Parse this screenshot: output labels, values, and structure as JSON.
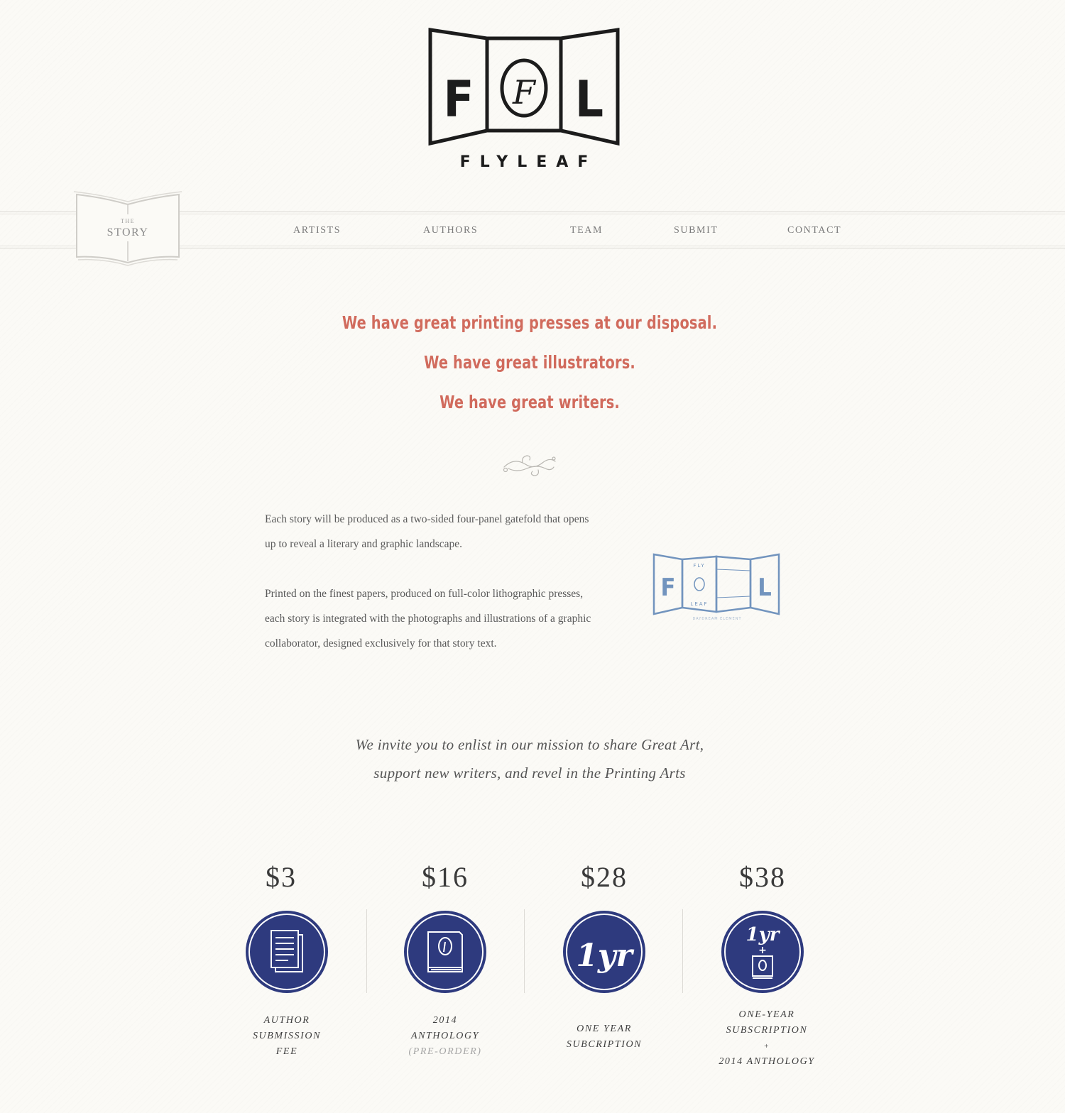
{
  "brand": {
    "wordmark": "FLYLEAF",
    "logo_letters": [
      "F",
      "F",
      "L"
    ]
  },
  "nav": {
    "story": {
      "small": "THE",
      "label": "STORY"
    },
    "items": [
      "ARTISTS",
      "AUTHORS",
      "TEAM",
      "SUBMIT",
      "CONTACT"
    ]
  },
  "headlines": [
    "We have great printing presses at our disposal.",
    "We have great illustrators.",
    "We have great writers."
  ],
  "body": {
    "paragraph_1": "Each story will be produced as a two-sided four-panel gatefold that opens up to reveal a literary and graphic landscape.",
    "paragraph_2": "Printed on the finest papers, produced on full-color lithographic presses, each story is integrated with the photographs and illustrations of a graphic collaborator, designed exclusively for that story text."
  },
  "gatefold": {
    "left_letter": "F",
    "right_letter": "L",
    "panel_top_text": "FLY",
    "panel_bottom_text": "LEAF",
    "caption": "DAYDREAM ELEMENT"
  },
  "invite": [
    "We invite you to enlist in our mission to share Great Art,",
    "support new writers, and revel in the Printing Arts"
  ],
  "pricing": [
    {
      "price": "$3",
      "icon": "document-icon",
      "lines": [
        "AUTHOR",
        "SUBMISSION",
        "FEE"
      ]
    },
    {
      "price": "$16",
      "icon": "book-icon",
      "lines": [
        "2014",
        "ANTHOLOGY",
        "(PRE-ORDER)"
      ]
    },
    {
      "price": "$28",
      "icon": "one-year-icon",
      "badge_text": "1yr",
      "lines": [
        "ONE YEAR",
        "SUBCRIPTION"
      ]
    },
    {
      "price": "$38",
      "icon": "one-year-plus-book-icon",
      "badge_text": "1yr",
      "badge_plus": "+",
      "lines": [
        "ONE-YEAR",
        "SUBSCRIPTION",
        "+",
        "2014 ANTHOLOGY"
      ]
    }
  ],
  "colors": {
    "background": "#fbfaf6",
    "headline": "#d16b5d",
    "badge": "#2e3a7e",
    "gatefold": "#7294be",
    "logo": "#1c1c1c"
  }
}
